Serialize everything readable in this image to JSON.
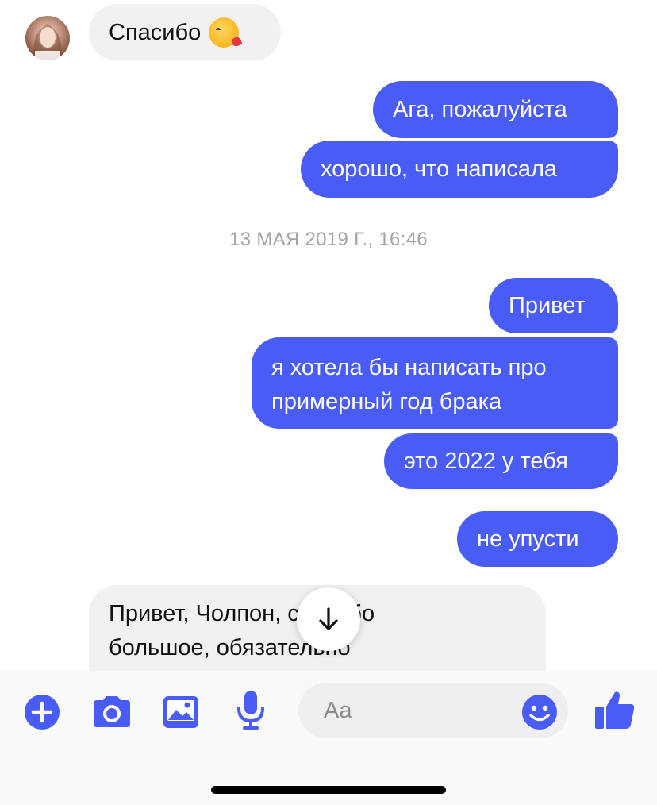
{
  "accent_color": "#4a5cf6",
  "messages": [
    {
      "id": "m1",
      "direction": "incoming",
      "text": "Спасибо",
      "emoji": "kissing-heart-emoji"
    },
    {
      "id": "m2",
      "direction": "outgoing",
      "text": "Ага, пожалуйста"
    },
    {
      "id": "m3",
      "direction": "outgoing",
      "text": "хорошо, что написала"
    },
    {
      "id": "m4",
      "direction": "outgoing",
      "text": "Привет"
    },
    {
      "id": "m5",
      "direction": "outgoing",
      "lines": [
        "я хотела бы написать про",
        "примерный год брака"
      ]
    },
    {
      "id": "m6",
      "direction": "outgoing",
      "text": "это 2022 у тебя"
    },
    {
      "id": "m7",
      "direction": "outgoing",
      "text": "не упусти"
    },
    {
      "id": "m8",
      "direction": "incoming",
      "lines": [
        "Привет, Чолпон, спасибо",
        "большое, обязательно"
      ]
    }
  ],
  "timestamp": "13 МАЯ 2019 Г., 16:46",
  "composer": {
    "placeholder": "Aa",
    "icons": [
      "plus-icon",
      "camera-icon",
      "image-icon",
      "microphone-icon",
      "smiley-icon",
      "thumbs-up-icon"
    ]
  },
  "scroll_button_icon": "arrow-down-icon"
}
